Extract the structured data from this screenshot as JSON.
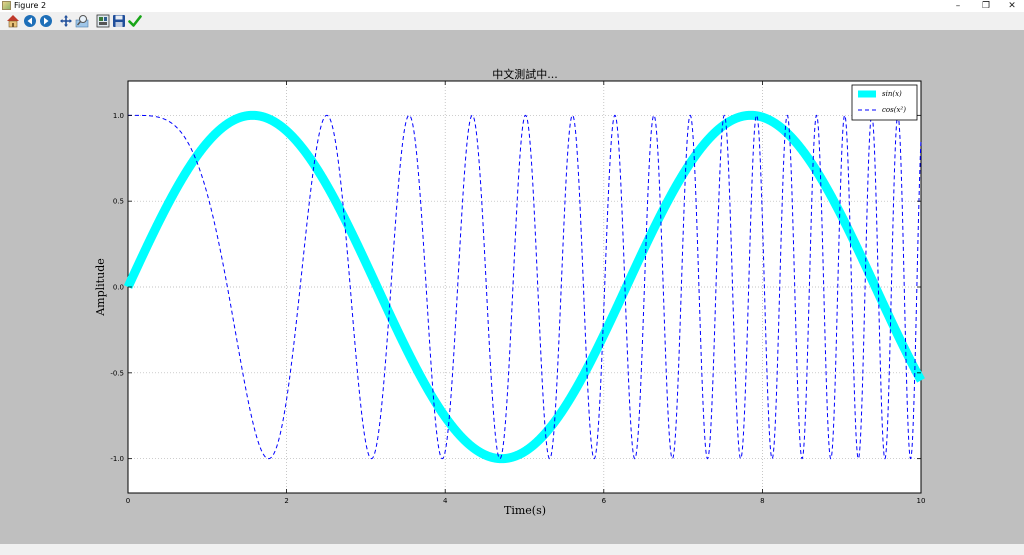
{
  "window": {
    "title": "Figure 2",
    "minimize_glyph": "–",
    "restore_glyph": "❐",
    "close_glyph": "✕"
  },
  "toolbar": {
    "tools": [
      {
        "icon": "home-icon"
      },
      {
        "icon": "back-arrow-icon"
      },
      {
        "icon": "forward-arrow-icon"
      },
      {
        "icon": "pan-icon"
      },
      {
        "icon": "zoom-icon"
      },
      {
        "icon": "configure-subplots-icon"
      },
      {
        "icon": "save-icon"
      },
      {
        "icon": "checkmark-icon"
      }
    ]
  },
  "chart_data": {
    "type": "line",
    "title": "中文測試中...",
    "xlabel": "Time(s)",
    "ylabel": "Amplitude",
    "xlim": [
      0,
      10
    ],
    "ylim": [
      -1.2,
      1.2
    ],
    "grid": true,
    "legend_position": "top-right",
    "x_ticks": [
      {
        "value": 0,
        "label": "0"
      },
      {
        "value": 2,
        "label": "2"
      },
      {
        "value": 4,
        "label": "4"
      },
      {
        "value": 6,
        "label": "6"
      },
      {
        "value": 8,
        "label": "8"
      },
      {
        "value": 10,
        "label": "10"
      }
    ],
    "y_ticks": [
      {
        "value": -1.0,
        "label": "-1.0"
      },
      {
        "value": -0.5,
        "label": "-0.5"
      },
      {
        "value": 0.0,
        "label": "0.0"
      },
      {
        "value": 0.5,
        "label": "0.5"
      },
      {
        "value": 1.0,
        "label": "1.0"
      }
    ],
    "series": [
      {
        "name": "sin(x)",
        "function": "sin(x)",
        "color": "#00ffff",
        "style": "solid",
        "width": "thick"
      },
      {
        "name": "cos(x²)",
        "function": "cos(x^2)",
        "color": "#0000ff",
        "style": "dashed",
        "width": "thin"
      }
    ]
  }
}
